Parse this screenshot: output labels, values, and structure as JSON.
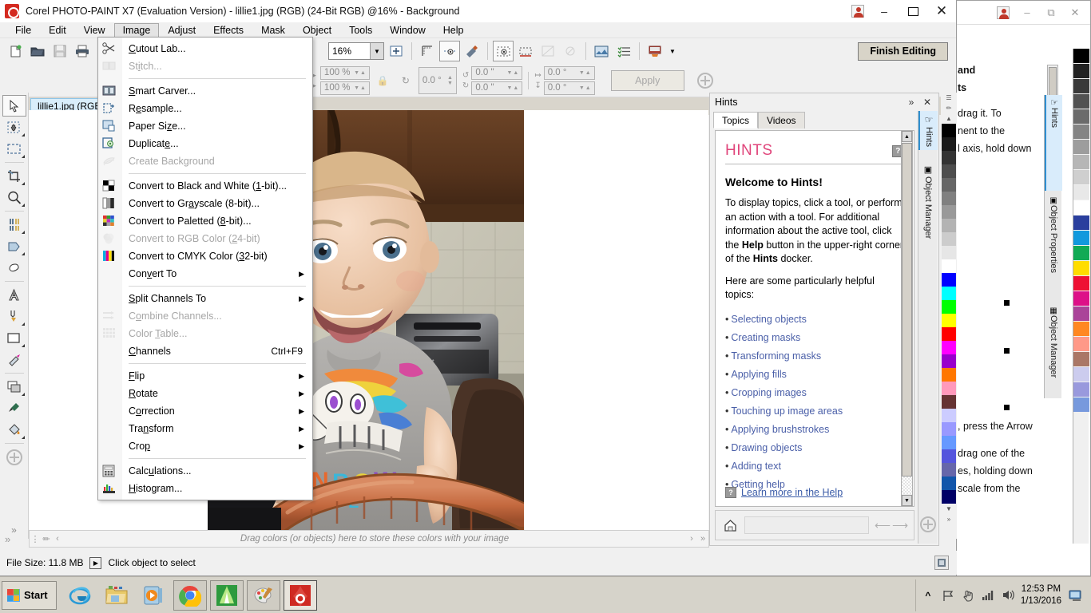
{
  "window": {
    "title": "Corel PHOTO-PAINT X7 (Evaluation Version) - lillie1.jpg (RGB) (24-Bit RGB) @16% - Background",
    "minimize_label": "–",
    "maximize_label": "▭",
    "close_label": "✕",
    "user_label": "user-account"
  },
  "menubar": {
    "items": [
      {
        "label": "File",
        "active": false
      },
      {
        "label": "Edit",
        "active": false
      },
      {
        "label": "View",
        "active": false
      },
      {
        "label": "Image",
        "active": true
      },
      {
        "label": "Adjust",
        "active": false
      },
      {
        "label": "Effects",
        "active": false
      },
      {
        "label": "Mask",
        "active": false
      },
      {
        "label": "Object",
        "active": false
      },
      {
        "label": "Tools",
        "active": false
      },
      {
        "label": "Window",
        "active": false
      },
      {
        "label": "Help",
        "active": false
      }
    ]
  },
  "image_menu": {
    "items": [
      {
        "label": "Cutout Lab...",
        "hot": "C",
        "icon": "scissors-icon",
        "disabled": false,
        "separator_after": false
      },
      {
        "label": "Stitch...",
        "hot": "i",
        "icon": "stitch-icon",
        "disabled": true,
        "separator_after": true
      },
      {
        "label": "Smart Carver...",
        "hot": "S",
        "icon": "smart-carver-icon",
        "disabled": false,
        "separator_after": false
      },
      {
        "label": "Resample...",
        "hot": "e",
        "icon": "resample-icon",
        "disabled": false,
        "separator_after": false
      },
      {
        "label": "Paper Size...",
        "hot": "z",
        "icon": "paper-size-icon",
        "disabled": false,
        "separator_after": false
      },
      {
        "label": "Duplicate...",
        "hot": "e",
        "icon": "duplicate-icon",
        "disabled": false,
        "separator_after": false
      },
      {
        "label": "Create Background",
        "hot": "g",
        "icon": "create-background-icon",
        "disabled": true,
        "separator_after": true
      },
      {
        "label": "Convert to Black and White (1-bit)...",
        "hot": "1",
        "icon": "bw-icon",
        "disabled": false,
        "separator_after": false
      },
      {
        "label": "Convert to Grayscale (8-bit)...",
        "hot": "a",
        "icon": "grayscale-icon",
        "disabled": false,
        "separator_after": false
      },
      {
        "label": "Convert to Paletted (8-bit)...",
        "hot": "8",
        "icon": "paletted-icon",
        "disabled": false,
        "separator_after": false
      },
      {
        "label": "Convert to RGB Color (24-bit)",
        "hot": "2",
        "icon": "rgb-icon",
        "disabled": true,
        "separator_after": false
      },
      {
        "label": "Convert to CMYK Color (32-bit)",
        "hot": "3",
        "icon": "cmyk-icon",
        "disabled": false,
        "separator_after": false
      },
      {
        "label": "Convert To",
        "hot": "v",
        "icon": "",
        "disabled": false,
        "submenu": true,
        "separator_after": true
      },
      {
        "label": "Split Channels To",
        "hot": "S",
        "icon": "",
        "disabled": false,
        "submenu": true,
        "separator_after": false
      },
      {
        "label": "Combine Channels...",
        "hot": "o",
        "icon": "combine-channels-icon",
        "disabled": true,
        "separator_after": false
      },
      {
        "label": "Color Table...",
        "hot": "T",
        "icon": "color-table-icon",
        "disabled": true,
        "separator_after": false
      },
      {
        "label": "Channels",
        "hot": "C",
        "icon": "",
        "disabled": false,
        "accel": "Ctrl+F9",
        "separator_after": true
      },
      {
        "label": "Flip",
        "hot": "F",
        "icon": "",
        "disabled": false,
        "submenu": true,
        "separator_after": false
      },
      {
        "label": "Rotate",
        "hot": "R",
        "icon": "",
        "disabled": false,
        "submenu": true,
        "separator_after": false
      },
      {
        "label": "Correction",
        "hot": "o",
        "icon": "",
        "disabled": false,
        "submenu": true,
        "separator_after": false
      },
      {
        "label": "Transform",
        "hot": "n",
        "icon": "",
        "disabled": false,
        "submenu": true,
        "separator_after": false
      },
      {
        "label": "Crop",
        "hot": "p",
        "icon": "",
        "disabled": false,
        "submenu": true,
        "separator_after": true
      },
      {
        "label": "Calculations...",
        "hot": "u",
        "icon": "calculations-icon",
        "disabled": false,
        "separator_after": false
      },
      {
        "label": "Histogram...",
        "hot": "H",
        "icon": "histogram-icon",
        "disabled": false,
        "separator_after": false
      }
    ]
  },
  "toolbar": {
    "new_label": "new-document",
    "open_label": "open",
    "save_label": "save",
    "print_label": "print",
    "zoom_level": "16%",
    "finish_editing_label": "Finish Editing",
    "apply_label": "Apply"
  },
  "property_bar": {
    "scale_x": "100 %",
    "scale_y": "100 %",
    "rotate": "0.0 °",
    "skew_h": "0.0 \"",
    "skew_v": "0.0 \"",
    "anchor_h": "0.0 °",
    "anchor_v": "0.0 °"
  },
  "document_tab": {
    "label": "lillie1.jpg (RGB)"
  },
  "toolbox": {
    "tools": [
      {
        "name": "pick-tool",
        "selected": true
      },
      {
        "name": "mask-transform-tool",
        "selected": false
      },
      {
        "name": "rectangle-mask-tool",
        "selected": false
      },
      {
        "name": "crop-tool",
        "selected": false
      },
      {
        "name": "zoom-tool",
        "selected": false
      },
      {
        "name": "clone-tool",
        "selected": false
      },
      {
        "name": "effect-tool",
        "selected": false
      },
      {
        "name": "eraser-tool",
        "selected": false
      },
      {
        "name": "text-tool",
        "selected": false
      },
      {
        "name": "paint-tool",
        "selected": false
      },
      {
        "name": "rectangle-shape-tool",
        "selected": false
      },
      {
        "name": "fill-tool",
        "selected": false
      },
      {
        "name": "object-transparency-tool",
        "selected": false
      },
      {
        "name": "eyedropper-tool",
        "selected": false
      },
      {
        "name": "paint-bucket-tool",
        "selected": false
      },
      {
        "name": "add-tool",
        "selected": false
      }
    ]
  },
  "color_bar": {
    "hint": "Drag colors (or objects) here to store these colors with your image"
  },
  "status_bar": {
    "file_size": "File Size: 11.8 MB",
    "message": "Click object to select"
  },
  "hints": {
    "panel_title": "Hints",
    "collapse_label": "»",
    "close_label": "✕",
    "tabs": [
      {
        "label": "Topics",
        "active": true
      },
      {
        "label": "Videos",
        "active": false
      }
    ],
    "heading": "HINTS",
    "help_icon_label": "?",
    "welcome": "Welcome to Hints!",
    "body_part1": "To display topics, click a tool, or perform an action with a tool. For additional information about the active tool, click the ",
    "body_bold1": "Help",
    "body_part2": " button in the upper-right corner of the ",
    "body_bold2": "Hints",
    "body_part3": " docker.",
    "intro_list": "Here are some particularly helpful topics:",
    "topics": [
      "Selecting objects",
      "Creating masks",
      "Transforming masks",
      "Applying fills",
      "Cropping images",
      "Touching up image areas",
      "Applying brushstrokes",
      "Drawing objects",
      "Adding text",
      "Getting help"
    ],
    "learn_more": "Learn more in the Help",
    "docker_tabs": [
      {
        "label": "Hints",
        "active": true,
        "icon": "hints-cursor-icon"
      },
      {
        "label": "Object Manager",
        "active": false,
        "icon": "object-manager-icon"
      }
    ]
  },
  "background_window": {
    "docker_tabs": [
      {
        "label": "Hints",
        "active": true
      },
      {
        "label": "Object Properties",
        "active": false
      },
      {
        "label": "Object Manager",
        "active": false
      }
    ],
    "text_lines": [
      "and",
      "ts",
      "drag it. To",
      "nent to the",
      "l axis, hold down",
      ", press the Arrow",
      "drag one of the",
      "es, holding down",
      "scale from the"
    ]
  },
  "palette": {
    "main_colors": [
      "#000000",
      "#1a1a1a",
      "#333333",
      "#4d4d4d",
      "#666666",
      "#808080",
      "#999999",
      "#b3b3b3",
      "#cccccc",
      "#e6e6e6",
      "#ffffff",
      "#0000ff",
      "#00ffff",
      "#00ff00",
      "#ffff00",
      "#ff0000",
      "#ff00ff",
      "#9900cc",
      "#ff7700",
      "#ff99bb",
      "#663333",
      "#ccccff",
      "#9999ff",
      "#6699ff",
      "#5555dd",
      "#6666aa",
      "#1155aa",
      "#000066"
    ],
    "bg_colors": [
      "#000000",
      "#222222",
      "#3a3a3a",
      "#525252",
      "#6b6b6b",
      "#848484",
      "#9d9d9d",
      "#b6b6b6",
      "#cfcfcf",
      "#e8e8e8",
      "#ffffff",
      "#2a3f9e",
      "#1199dd",
      "#11aa55",
      "#ffdd00",
      "#ee1133",
      "#dd1188",
      "#aa4499",
      "#ff8822",
      "#ff9988",
      "#aa7766",
      "#ccccee",
      "#9999dd",
      "#7799dd"
    ]
  },
  "taskbar": {
    "start_label": "Start",
    "apps": [
      {
        "name": "internet-explorer-icon",
        "running": false
      },
      {
        "name": "file-explorer-icon",
        "running": false
      },
      {
        "name": "media-player-icon",
        "running": false
      },
      {
        "name": "google-chrome-icon",
        "running": true
      },
      {
        "name": "coreldraw-icon",
        "running": true
      },
      {
        "name": "paint-shop-icon",
        "running": true
      },
      {
        "name": "corel-photo-paint-icon",
        "running": true
      }
    ],
    "tray": [
      {
        "name": "show-hidden-icons-icon",
        "glyph": "»"
      },
      {
        "name": "flag-action-center-icon",
        "glyph": "⚑"
      },
      {
        "name": "touch-pointer-icon",
        "glyph": "☝"
      },
      {
        "name": "network-signal-icon",
        "glyph": "▂▄▆"
      },
      {
        "name": "volume-icon",
        "glyph": "🔊"
      }
    ],
    "time": "12:53 PM",
    "date": "1/13/2016"
  }
}
